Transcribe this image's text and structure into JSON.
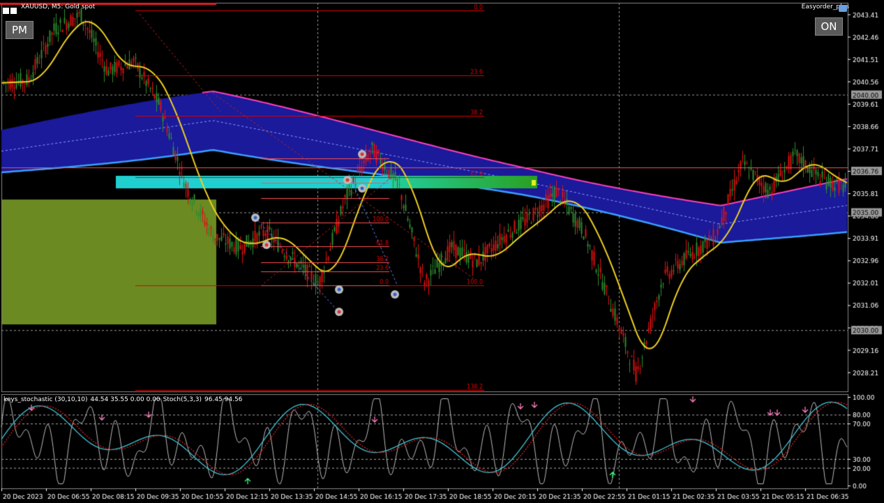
{
  "header": {
    "symbol_info": "XAUUSD, M5:  Gold spot",
    "ea_name": "Easyorder_plus"
  },
  "buttons": {
    "pm": "PM",
    "on": "ON"
  },
  "price_axis": {
    "labels": [
      "2043.41",
      "2042.46",
      "2041.51",
      "2040.56",
      "2039.61",
      "2038.66",
      "2037.71",
      "2036.76",
      "2035.81",
      "2034.86",
      "2033.91",
      "2032.96",
      "2032.01",
      "2031.06",
      "2030.11",
      "2029.16",
      "2028.21"
    ],
    "highlighted": [
      {
        "label": "2040.00",
        "price": 2040.0
      },
      {
        "label": "2036.76",
        "price": 2036.76
      },
      {
        "label": "2035.00",
        "price": 2035.0
      },
      {
        "label": "2030.00",
        "price": 2030.0
      }
    ]
  },
  "time_axis": [
    "20 Dec 2023",
    "20 Dec 06:55",
    "20 Dec 08:15",
    "20 Dec 09:35",
    "20 Dec 10:55",
    "20 Dec 12:15",
    "20 Dec 13:35",
    "20 Dec 14:55",
    "20 Dec 16:15",
    "20 Dec 17:35",
    "20 Dec 18:55",
    "20 Dec 20:15",
    "20 Dec 21:35",
    "20 Dec 22:55",
    "21 Dec 01:15",
    "21 Dec 02:35",
    "21 Dec 03:55",
    "21 Dec 05:15",
    "21 Dec 06:35"
  ],
  "fib_main": [
    "0.0",
    "23.6",
    "38.2",
    "61.8",
    "100.0",
    "138.2"
  ],
  "fib_small": [
    "100.0",
    "61.8",
    "38.2",
    "23.6",
    "0.0"
  ],
  "oscillator": {
    "label_1": "keys_stochastic (30,10,10)",
    "label_2": "44.54 35.55 0.00 0.00",
    "label_3": "Stoch(5,3,3)",
    "label_4": "96.45 94.56",
    "levels": [
      "100.00",
      "80.00",
      "70.00",
      "30.00",
      "20.00",
      "0.00"
    ]
  },
  "colors": {
    "bull": "#2e8b2e",
    "bear": "#e01010",
    "ma_yellow": "#f0d020",
    "cloud": "#1a1a9a",
    "band_blue": "#3aa0ff",
    "band_pink": "#ff40c0",
    "fib_red": "#e00000",
    "olive": "#6b8a22",
    "cyan": "#20d0d0"
  },
  "chart_data": {
    "type": "candlestick",
    "symbol": "XAUUSD",
    "timeframe": "M5",
    "y_range": [
      2027.4,
      2043.9
    ],
    "approx_close_path": [
      2040.5,
      2040.6,
      2042.8,
      2043.4,
      2041.0,
      2041.4,
      2039.5,
      2036.0,
      2034.0,
      2033.5,
      2034.2,
      2033.0,
      2032.0,
      2035.6,
      2037.7,
      2036.2,
      2032.0,
      2033.5,
      2032.9,
      2034.0,
      2034.8,
      2035.9,
      2034.2,
      2031.2,
      2028.1,
      2032.2,
      2033.2,
      2034.0,
      2037.1,
      2035.9,
      2037.4,
      2036.4,
      2036.0
    ]
  }
}
